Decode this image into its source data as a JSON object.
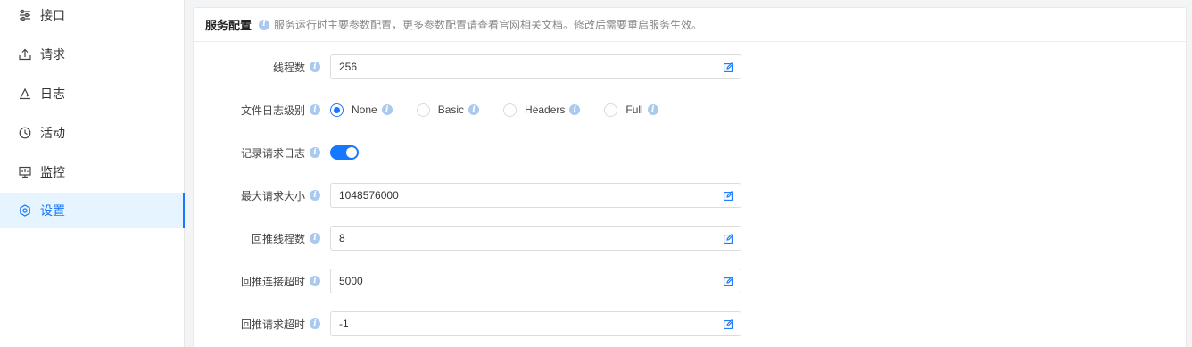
{
  "sidebar": {
    "items": [
      {
        "label": "接口",
        "icon": "sliders-icon"
      },
      {
        "label": "请求",
        "icon": "upload-icon"
      },
      {
        "label": "日志",
        "icon": "log-icon"
      },
      {
        "label": "活动",
        "icon": "clock-icon"
      },
      {
        "label": "监控",
        "icon": "monitor-icon"
      },
      {
        "label": "设置",
        "icon": "settings-icon",
        "active": true
      }
    ]
  },
  "panel": {
    "title": "服务配置",
    "description": "服务运行时主要参数配置，更多参数配置请查看官网相关文档。修改后需要重启服务生效。"
  },
  "form": {
    "threads": {
      "label": "线程数",
      "value": "256"
    },
    "file_log_level": {
      "label": "文件日志级别",
      "options": [
        "None",
        "Basic",
        "Headers",
        "Full"
      ],
      "selected": "None"
    },
    "record_request_log": {
      "label": "记录请求日志",
      "enabled": true
    },
    "max_request_size": {
      "label": "最大请求大小",
      "value": "1048576000"
    },
    "callback_threads": {
      "label": "回推线程数",
      "value": "8"
    },
    "callback_connect_timeout": {
      "label": "回推连接超时",
      "value": "5000"
    },
    "callback_request_timeout": {
      "label": "回推请求超时",
      "value": "-1"
    }
  },
  "colors": {
    "accent": "#1677ff",
    "info_icon": "#a9c9ef"
  }
}
